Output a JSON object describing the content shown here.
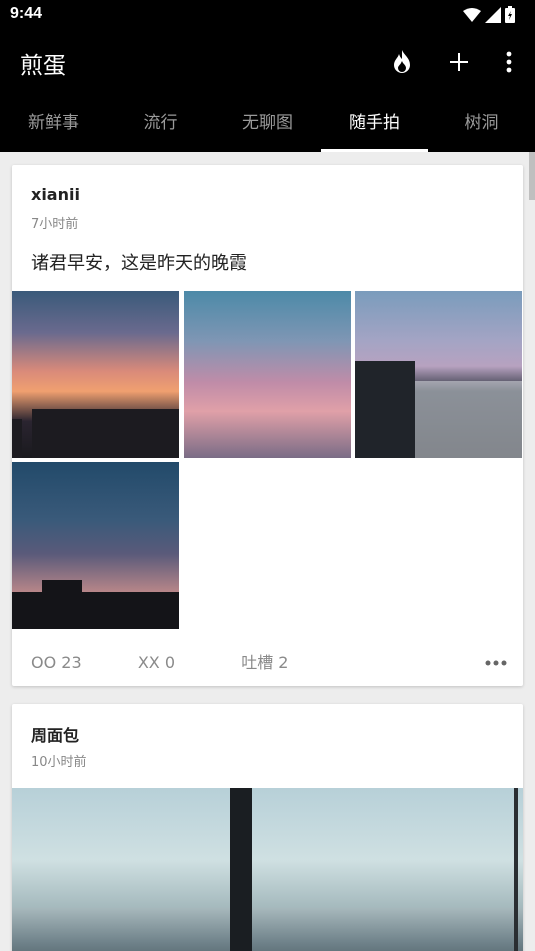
{
  "status_bar": {
    "time": "9:44"
  },
  "app_bar": {
    "title": "煎蛋"
  },
  "tabs": [
    {
      "label": "新鲜事"
    },
    {
      "label": "流行"
    },
    {
      "label": "无聊图"
    },
    {
      "label": "随手拍",
      "active": true
    },
    {
      "label": "树洞"
    }
  ],
  "posts": [
    {
      "author": "xianii",
      "time": "7小时前",
      "content": "诸君早安，这是昨天的晚霞",
      "oo": "OO 23",
      "xx": "XX 0",
      "comments": "吐槽 2"
    },
    {
      "author": "周面包",
      "time": "10小时前"
    }
  ],
  "colors": {
    "bar": "#000000",
    "tab_active": "#ffffff",
    "tab_inactive": "#9a9a9a"
  }
}
